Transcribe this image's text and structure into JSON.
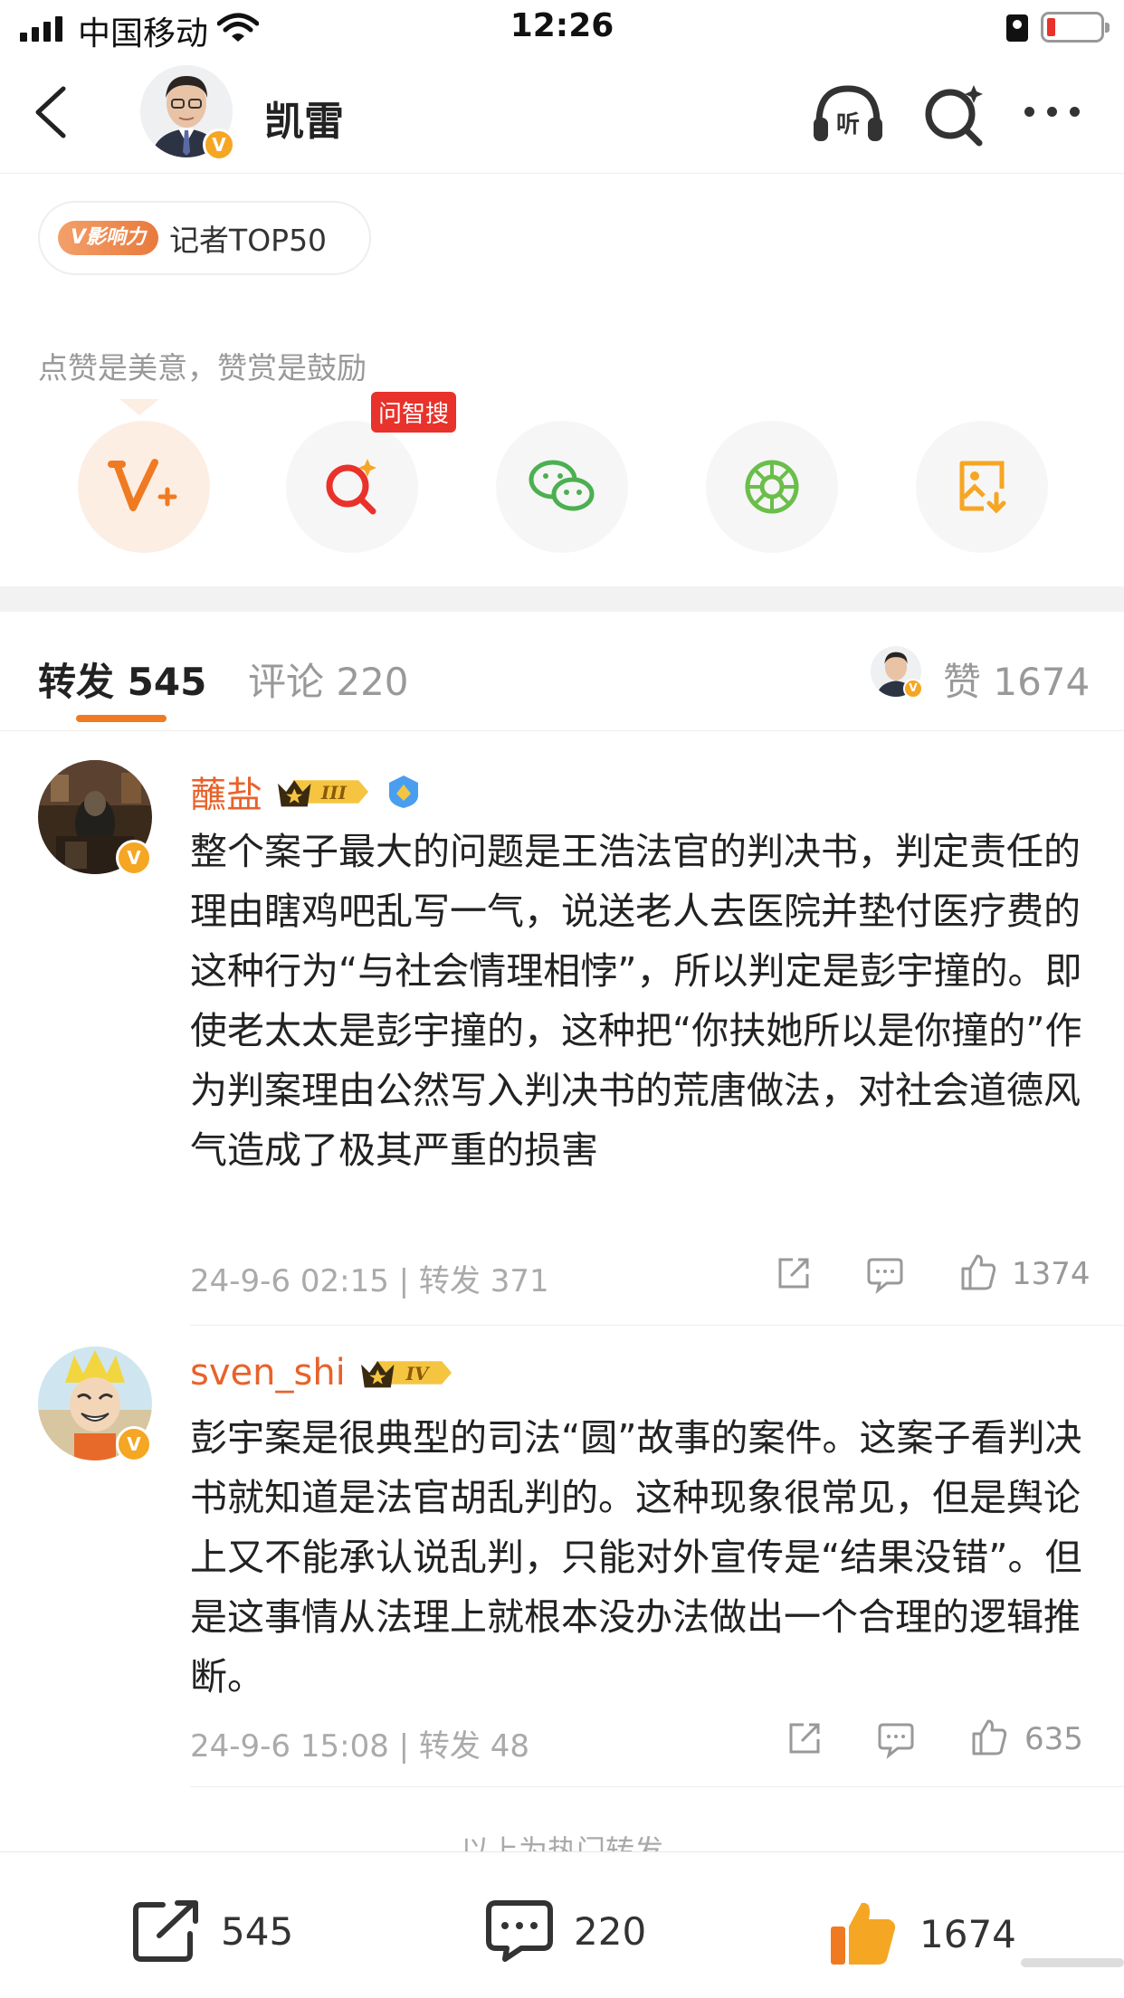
{
  "status_bar": {
    "carrier": "中国移动",
    "time": "12:26"
  },
  "header": {
    "name": "凯雷",
    "badge": "V"
  },
  "influence": {
    "tag": "V影响力",
    "label": "记者TOP50"
  },
  "reward_tip": "点赞是美意，赞赏是鼓励",
  "actions": {
    "search_tip": "问智搜",
    "items": [
      "v-plus-icon",
      "ai-search-icon",
      "wechat-icon",
      "moments-icon",
      "save-image-icon"
    ]
  },
  "tabs": {
    "repost_label": "转发 545",
    "comment_label": "评论 220",
    "likes_label": "赞 1674"
  },
  "posts": [
    {
      "name": "蘸盐",
      "level": "III",
      "text": "整个案子最大的问题是王浩法官的判决书，判定责任的理由瞎鸡吧乱写一气，说送老人去医院并垫付医疗费的这种行为“与社会情理相悖”，所以判定是彭宇撞的。即使老太太是彭宇撞的，这种把“你扶她所以是你撞的”作为判案理由公然写入判决书的荒唐做法，对社会道德风气造成了极其严重的损害",
      "meta": "24-9-6 02:15 | 转发 371",
      "likes": "1374"
    },
    {
      "name": "sven_shi",
      "level": "IV",
      "text": "彭宇案是很典型的司法“圆”故事的案件。这案子看判决书就知道是法官胡乱判的。这种现象很常见，但是舆论上又不能承认说乱判，只能对外宣传是“结果没错”。但是这事情从法理上就根本没办法做出一个合理的逻辑推断。",
      "meta": "24-9-6 15:08 | 转发 48",
      "likes": "635"
    }
  ],
  "hot_label": "以上为热门转发",
  "bottom_bar": {
    "reposts": "545",
    "comments": "220",
    "likes": "1674"
  },
  "colors": {
    "accent": "#f07a22",
    "username": "#e8622a",
    "verified": "#f5a623",
    "tip_red": "#e8322b"
  }
}
